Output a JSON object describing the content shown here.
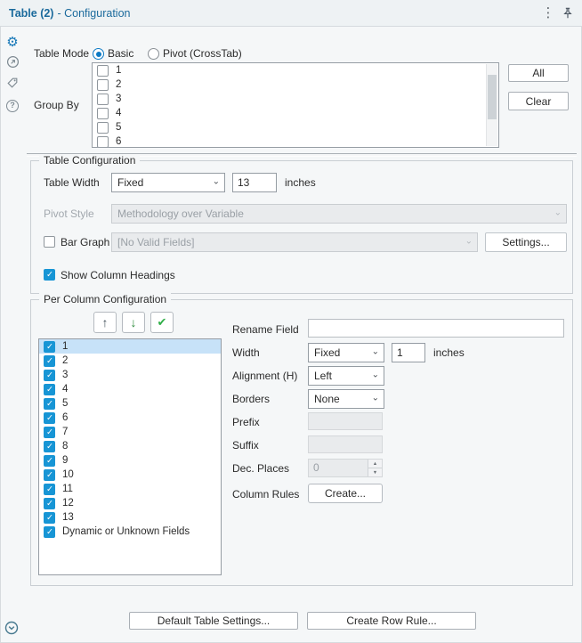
{
  "header": {
    "title": "Table (2)",
    "subtitle": "- Configuration"
  },
  "icons": {
    "kebab": "⋮",
    "gear": "⚙",
    "help": "?",
    "chevron": "⌄",
    "move_up": "↑",
    "move_down": "↓",
    "check": "✔",
    "spin_up": "▲",
    "spin_down": "▼"
  },
  "table_mode": {
    "label": "Table Mode",
    "basic": "Basic",
    "pivot": "Pivot (CrossTab)"
  },
  "group_by": {
    "label": "Group By",
    "items": [
      "1",
      "2",
      "3",
      "4",
      "5",
      "6"
    ],
    "all": "All",
    "clear": "Clear"
  },
  "table_config": {
    "title": "Table Configuration",
    "table_width_label": "Table Width",
    "table_width_mode": "Fixed",
    "table_width_value": "13",
    "table_width_unit": "inches",
    "pivot_style_label": "Pivot Style",
    "pivot_style_value": "Methodology over Variable",
    "bar_graph_label": "Bar Graph",
    "bar_graph_value": "[No Valid Fields]",
    "settings": "Settings...",
    "show_column_headings": "Show Column Headings"
  },
  "per_column": {
    "title": "Per Column Configuration",
    "fields": [
      "1",
      "2",
      "3",
      "4",
      "5",
      "6",
      "7",
      "8",
      "9",
      "10",
      "11",
      "12",
      "13",
      "Dynamic or Unknown Fields"
    ],
    "selected_index": 0,
    "rename_label": "Rename Field",
    "rename_value": "",
    "width_label": "Width",
    "width_mode": "Fixed",
    "width_value": "1",
    "width_unit": "inches",
    "alignment_label": "Alignment (H)",
    "alignment_value": "Left",
    "borders_label": "Borders",
    "borders_value": "None",
    "prefix_label": "Prefix",
    "suffix_label": "Suffix",
    "dec_places_label": "Dec. Places",
    "dec_places_value": "0",
    "column_rules_label": "Column Rules",
    "create": "Create..."
  },
  "footer": {
    "default_table_settings": "Default Table Settings...",
    "create_row_rule": "Create Row Rule..."
  },
  "colors": {
    "accent_blue": "#1795d5",
    "title_blue": "#1b6a9c",
    "selection": "#c7e2f8",
    "green_check": "#2fae47"
  }
}
